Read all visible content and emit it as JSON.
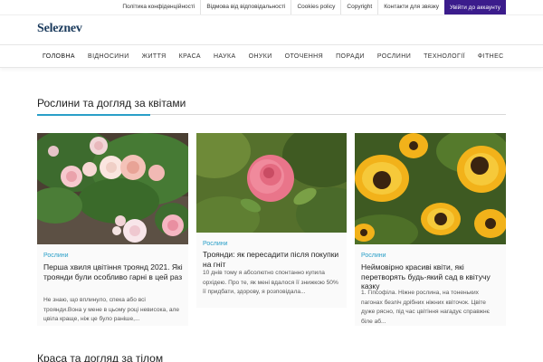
{
  "topbar": {
    "links": [
      "Політика конфіденційності",
      "Відмова від відповідальності",
      "Cookies policy",
      "Copyright",
      "Контакти для звязку"
    ],
    "login_label": "Увійти до аккаунту"
  },
  "header": {
    "logo": "Seleznev"
  },
  "nav": {
    "items": [
      "ГОЛОВНА",
      "ВІДНОСИНИ",
      "ЖИТТЯ",
      "КРАСА",
      "НАУКА",
      "ОНУКИ",
      "ОТОЧЕННЯ",
      "ПОРАДИ",
      "РОСЛИНИ",
      "ТЕХНОЛОГІЇ",
      "ФІТНЕС"
    ]
  },
  "section": {
    "title": "Рослини та догляд за квітами",
    "accent_color": "#2a9fc8"
  },
  "cards": [
    {
      "image": "roses-bush-photo",
      "category": "Рослини",
      "title": "Перша хвиля цвітіння троянд 2021. Які троянди були особливо гарні в цей раз",
      "excerpt": "Не знаю, що вплинуло, спека або всі троянди.Вона у мене в цьому році невисока, але цвіла краще, ніж це було раніше,..."
    },
    {
      "image": "pink-rose-photo",
      "category": "Рослини",
      "title": "Троянди: як пересадити після покупки на гніт",
      "excerpt": "10 днів тому я абсолютно спонтанно купила орхідею. Про те, як мені вдалося її знижкою 50% її придбати, здорову, я розповідала..."
    },
    {
      "image": "yellow-flowers-photo",
      "category": "Рослини",
      "title": "Неймовірно красиві квіти, які перетворять будь-який сад в квітучу казку",
      "excerpt": "1. Гіпсофіла. Ніжне рослина, на тоненьких пагонах безліч дрібних ніжних квіточок. Цвіте дуже рясно, під час цвітіння нагадує справжнє біле аб..."
    }
  ],
  "section2": {
    "title": "Краса та догляд за тілом"
  },
  "colors": {
    "login_bg": "#3b1c8c",
    "logo": "#1a3a5c"
  }
}
